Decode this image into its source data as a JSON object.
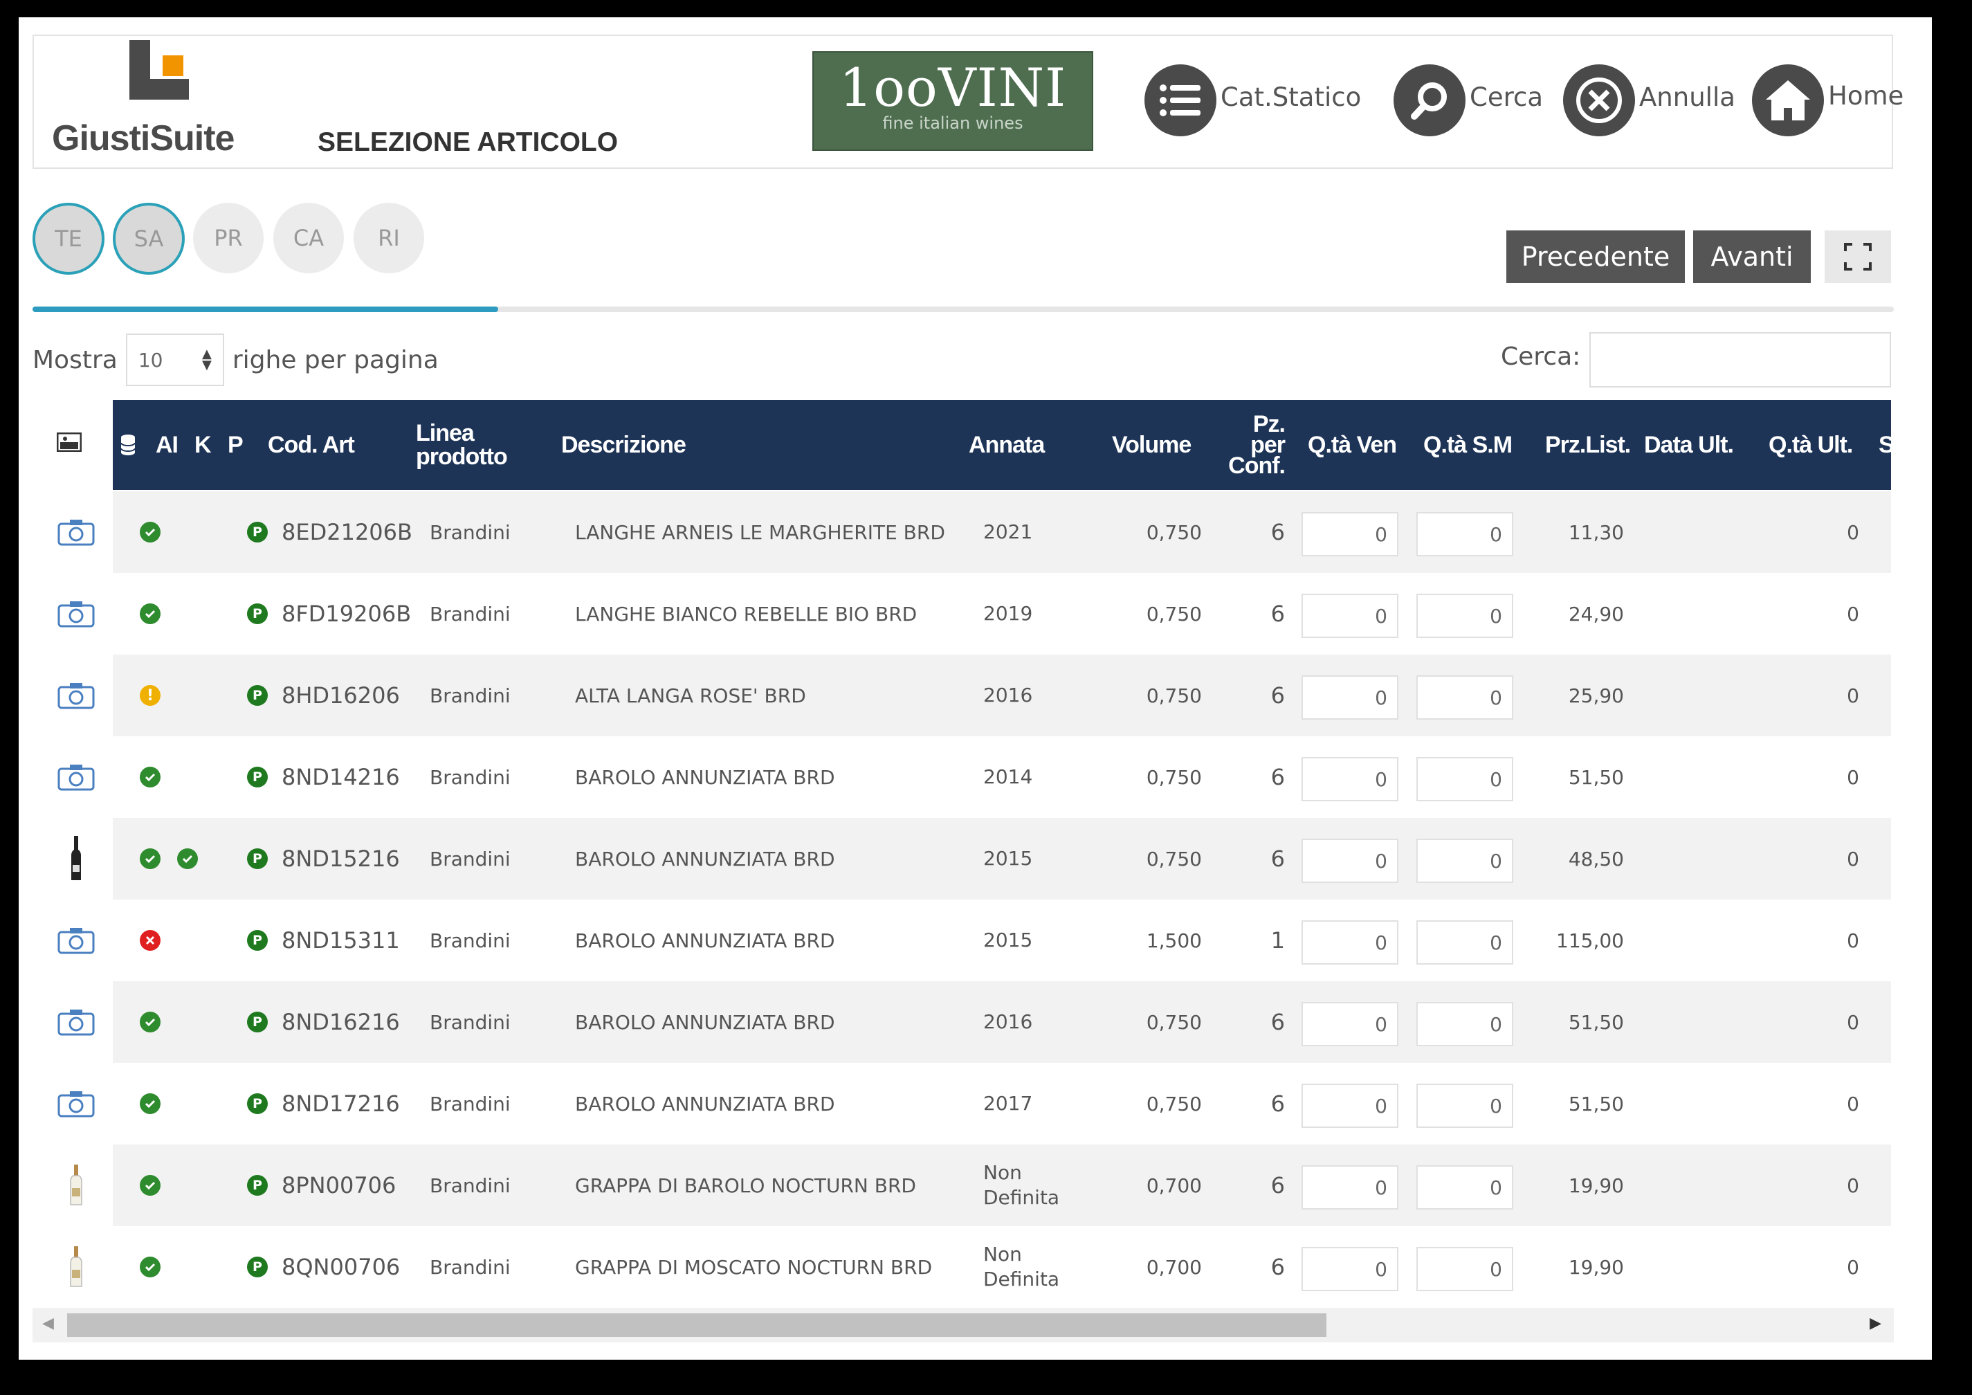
{
  "header": {
    "logo_text": "GiustiSuite",
    "page_title": "SELEZIONE ARTICOLO",
    "brand_name": "1ooVINI",
    "brand_tagline": "fine italian wines",
    "buttons": [
      {
        "label": "Cat.Statico",
        "icon": "list-icon"
      },
      {
        "label": "Cerca",
        "icon": "search-icon"
      },
      {
        "label": "Annulla",
        "icon": "cancel-icon"
      },
      {
        "label": "Home",
        "icon": "home-icon"
      }
    ]
  },
  "steps": [
    "TE",
    "SA",
    "PR",
    "CA",
    "RI"
  ],
  "active_steps": [
    "TE",
    "SA"
  ],
  "progress_fraction": 0.25,
  "nav": {
    "prev": "Precedente",
    "next": "Avanti",
    "expand_icon": "expand-icon"
  },
  "length": {
    "prefix": "Mostra",
    "value": "10",
    "suffix": "righe per pagina"
  },
  "search": {
    "label": "Cerca:",
    "value": ""
  },
  "columns": {
    "ai": "AI",
    "k": "K",
    "p": "P",
    "cod": "Cod. Art",
    "linea_1": "Linea",
    "linea_2": "prodotto",
    "desc": "Descrizione",
    "annata": "Annata",
    "volume": "Volume",
    "pz_1": "Pz.",
    "pz_2": "per",
    "pz_3": "Conf.",
    "qven": "Q.tà Ven",
    "qsm": "Q.tà S.M",
    "przlist": "Prz.List.",
    "dataul": "Data Ult.",
    "qtaul": "Q.tà Ult.",
    "sc": "Sc."
  },
  "colors": {
    "header_bg": "#1e3457",
    "accent": "#2d9cc0",
    "ok": "#2e8b2e",
    "warn": "#f0b000",
    "error": "#e02020"
  },
  "rows": [
    {
      "img": "camera",
      "status": "ok",
      "ai": "",
      "p": "P",
      "cod": "8ED21206B",
      "linea": "Brandini",
      "desc": "LANGHE ARNEIS LE MARGHERITE BRD",
      "annata_1": "2021",
      "annata_2": "",
      "volume": "0,750",
      "pz": "6",
      "qven": "0",
      "qsm": "0",
      "prz": "11,30",
      "qtaul": "0"
    },
    {
      "img": "camera",
      "status": "ok",
      "ai": "",
      "p": "P",
      "cod": "8FD19206B",
      "linea": "Brandini",
      "desc": "LANGHE BIANCO REBELLE BIO BRD",
      "annata_1": "2019",
      "annata_2": "",
      "volume": "0,750",
      "pz": "6",
      "qven": "0",
      "qsm": "0",
      "prz": "24,90",
      "qtaul": "0"
    },
    {
      "img": "camera",
      "status": "warn",
      "ai": "",
      "p": "P",
      "cod": "8HD16206",
      "linea": "Brandini",
      "desc": "ALTA LANGA ROSE' BRD",
      "annata_1": "2016",
      "annata_2": "",
      "volume": "0,750",
      "pz": "6",
      "qven": "0",
      "qsm": "0",
      "prz": "25,90",
      "qtaul": "0"
    },
    {
      "img": "camera",
      "status": "ok",
      "ai": "",
      "p": "P",
      "cod": "8ND14216",
      "linea": "Brandini",
      "desc": "BAROLO ANNUNZIATA BRD",
      "annata_1": "2014",
      "annata_2": "",
      "volume": "0,750",
      "pz": "6",
      "qven": "0",
      "qsm": "0",
      "prz": "51,50",
      "qtaul": "0"
    },
    {
      "img": "bottle-dark",
      "status": "ok",
      "ai": "ok",
      "p": "P",
      "cod": "8ND15216",
      "linea": "Brandini",
      "desc": "BAROLO ANNUNZIATA BRD",
      "annata_1": "2015",
      "annata_2": "",
      "volume": "0,750",
      "pz": "6",
      "qven": "0",
      "qsm": "0",
      "prz": "48,50",
      "qtaul": "0"
    },
    {
      "img": "camera",
      "status": "error",
      "ai": "",
      "p": "P",
      "cod": "8ND15311",
      "linea": "Brandini",
      "desc": "BAROLO ANNUNZIATA BRD",
      "annata_1": "2015",
      "annata_2": "",
      "volume": "1,500",
      "pz": "1",
      "qven": "0",
      "qsm": "0",
      "prz": "115,00",
      "qtaul": "0"
    },
    {
      "img": "camera",
      "status": "ok",
      "ai": "",
      "p": "P",
      "cod": "8ND16216",
      "linea": "Brandini",
      "desc": "BAROLO ANNUNZIATA BRD",
      "annata_1": "2016",
      "annata_2": "",
      "volume": "0,750",
      "pz": "6",
      "qven": "0",
      "qsm": "0",
      "prz": "51,50",
      "qtaul": "0"
    },
    {
      "img": "camera",
      "status": "ok",
      "ai": "",
      "p": "P",
      "cod": "8ND17216",
      "linea": "Brandini",
      "desc": "BAROLO ANNUNZIATA BRD",
      "annata_1": "2017",
      "annata_2": "",
      "volume": "0,750",
      "pz": "6",
      "qven": "0",
      "qsm": "0",
      "prz": "51,50",
      "qtaul": "0"
    },
    {
      "img": "bottle-light",
      "status": "ok",
      "ai": "",
      "p": "P",
      "cod": "8PN00706",
      "linea": "Brandini",
      "desc": "GRAPPA DI BAROLO NOCTURN BRD",
      "annata_1": "Non",
      "annata_2": "Definita",
      "volume": "0,700",
      "pz": "6",
      "qven": "0",
      "qsm": "0",
      "prz": "19,90",
      "qtaul": "0"
    },
    {
      "img": "bottle-light",
      "status": "ok",
      "ai": "",
      "p": "P",
      "cod": "8QN00706",
      "linea": "Brandini",
      "desc": "GRAPPA DI MOSCATO NOCTURN BRD",
      "annata_1": "Non",
      "annata_2": "Definita",
      "volume": "0,700",
      "pz": "6",
      "qven": "0",
      "qsm": "0",
      "prz": "19,90",
      "qtaul": "0"
    }
  ]
}
